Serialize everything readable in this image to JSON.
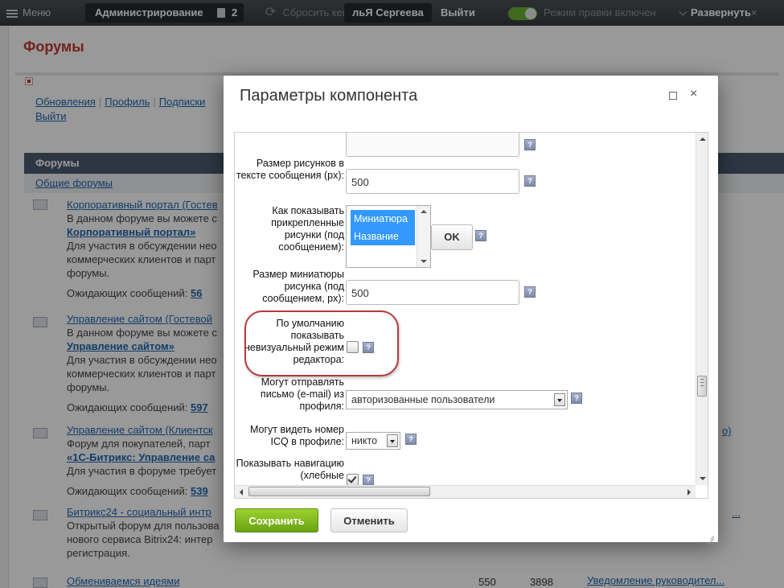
{
  "topbar": {
    "menu": "Меню",
    "admin": "Администрирование",
    "badge_count": "2",
    "reset_cache": "Сбросить кеш",
    "user": "льЯ Сергеева",
    "logout": "Выйти",
    "edit_mode": "Режим правки включен",
    "expand": "Развернуть",
    "close": "×"
  },
  "page": {
    "title": "Форумы",
    "links": [
      "Обновления",
      "Профиль",
      "Подписки",
      "Выйти"
    ],
    "forum_header": "Форумы",
    "section": "Общие форумы",
    "rows": [
      {
        "title": "Корпоративный портал (Гостев",
        "lines": [
          "В данном форуме вы можете с"
        ],
        "bold_link": "Корпоративный портал»",
        "lines2": [
          "Для участия в обсуждении нео",
          "коммерческих клиентов и парт",
          "форумы."
        ],
        "wait_label": "Ожидающих сообщений:",
        "wait_value": "56"
      },
      {
        "title": "Управление сайтом (Гостевой",
        "lines": [
          "В данном форуме вы можете с"
        ],
        "bold_link": "Управление сайтом»",
        "lines2": [
          "Для участия в обсуждении нео",
          "коммерческих клиентов и парт",
          "форумы."
        ],
        "wait_label": "Ожидающих сообщений:",
        "wait_value": "597"
      },
      {
        "title": "Управление сайтом (Клиентск",
        "lines": [
          "Форум для покупателей, парт"
        ],
        "bold_link": "«1С-Битрикс: Управление са",
        "lines2": [
          "Для участия в форуме требует"
        ],
        "wait_label": "Ожидающих сообщений:",
        "wait_value": "539",
        "right_text": "о)"
      },
      {
        "title": "Битрикс24 - социальный интр",
        "lines": [
          "Открытый форум для пользова",
          "нового сервиса Bitrix24: интер",
          "регистрация."
        ],
        "right_text": "..."
      },
      {
        "title": "Обмениваемся идеями",
        "num1": "550",
        "num2": "3898",
        "right_text": "Уведомление руководител..."
      }
    ]
  },
  "dialog": {
    "title": "Параметры компонента",
    "close_icon": "×",
    "help_glyph": "?",
    "fields": {
      "img_size_label": "Размер рисунков в тексте сообщения (px):",
      "img_size_value": "500",
      "attached_label": "Как показывать прикрепленные рисунки (под сообщением):",
      "attached_options": [
        "Миниатюра",
        "Название"
      ],
      "ok_label": "OK",
      "thumb_size_label": "Размер миниатюры рисунка (под сообщением, px):",
      "thumb_size_value": "500",
      "default_editor_label": "По умолчанию показывать невизуальный режим редактора:",
      "default_editor_checked": false,
      "email_label": "Могут отправлять письмо (e-mail) из профиля:",
      "email_value": "авторизованные пользователи",
      "icq_label": "Могут видеть номер ICQ в профиле:",
      "icq_value": "никто",
      "nav_label": "Показывать навигацию (хлебные",
      "nav_checked": true
    },
    "save_label": "Сохранить",
    "cancel_label": "Отменить"
  }
}
